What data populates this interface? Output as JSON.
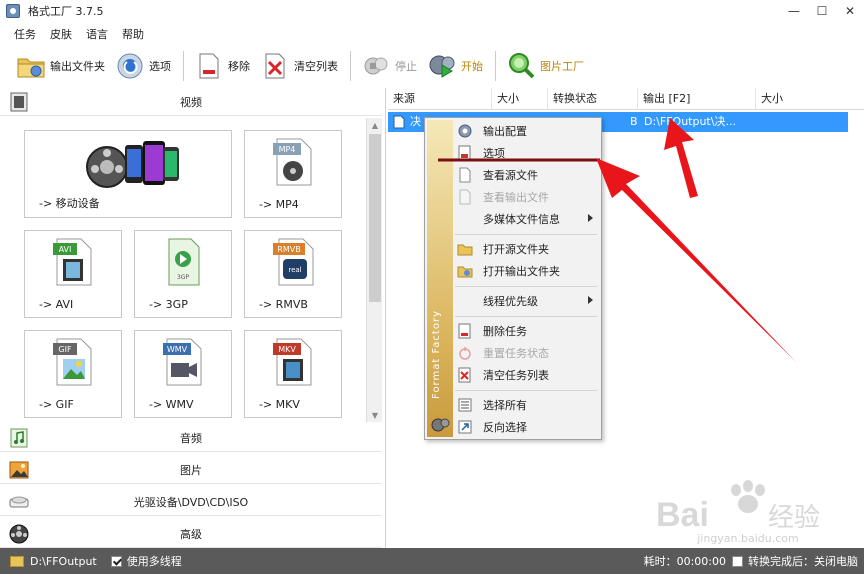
{
  "window": {
    "title": "格式工厂 3.7.5",
    "min_glyph": "—",
    "max_glyph": "☐",
    "close_glyph": "✕"
  },
  "menubar": {
    "items": [
      {
        "label": "任务"
      },
      {
        "label": "皮肤"
      },
      {
        "label": "语言"
      },
      {
        "label": "帮助"
      }
    ]
  },
  "toolbar": {
    "output_folder": "输出文件夹",
    "options": "选项",
    "remove": "移除",
    "clear_list": "清空列表",
    "stop": "停止",
    "start": "开始",
    "picture_factory": "图片工厂"
  },
  "left_panel": {
    "video": "视频",
    "audio": "音频",
    "picture": "图片",
    "rom": "光驱设备\\DVD\\CD\\ISO",
    "advanced": "高级",
    "tiles": {
      "mobile": {
        "label": "-> 移动设备"
      },
      "mp4": {
        "label": "-> MP4",
        "badge": "MP4"
      },
      "avi": {
        "label": "-> AVI",
        "badge": "AVI"
      },
      "3gp": {
        "label": "-> 3GP",
        "badge": "3GP"
      },
      "rmvb": {
        "label": "-> RMVB",
        "badge": "RMVB",
        "badge2": "real"
      },
      "gif": {
        "label": "-> GIF",
        "badge": "GIF"
      },
      "wmv": {
        "label": "-> WMV",
        "badge": "WMV"
      },
      "mkv": {
        "label": "-> MKV",
        "badge": "MKV"
      }
    }
  },
  "task_list": {
    "columns": [
      "来源",
      "大小",
      "转换状态",
      "输出 [F2]",
      "大小"
    ],
    "row": {
      "source": "决",
      "size": "",
      "status": "B",
      "output": "D:\\FFOutput\\决..."
    }
  },
  "context_menu": {
    "side_text": "Format Factory",
    "items": {
      "output_config": "输出配置",
      "options": "选项",
      "view_source": "查看源文件",
      "view_output": "查看输出文件",
      "media_info": "多媒体文件信息",
      "open_source_folder": "打开源文件夹",
      "open_output_folder": "打开输出文件夹",
      "thread_priority": "线程优先级",
      "delete_task": "删除任务",
      "reset_status": "重置任务状态",
      "clear_tasks": "清空任务列表",
      "select_all": "选择所有",
      "invert_selection": "反向选择"
    }
  },
  "statusbar": {
    "output_path": "D:\\FFOutput",
    "multithread": "使用多线程",
    "elapsed": "耗时：00:00:00",
    "after_convert": "转换完成后：关闭电脑"
  },
  "watermark": {
    "brand": "Bai",
    "brand2": "经验",
    "url": "jingyan.baidu.com"
  },
  "colors": {
    "selection": "#3399ff",
    "annotation_arrow": "#e8151b",
    "annotation_line": "#7a0f0f",
    "statusbar": "#5a5a5a"
  }
}
